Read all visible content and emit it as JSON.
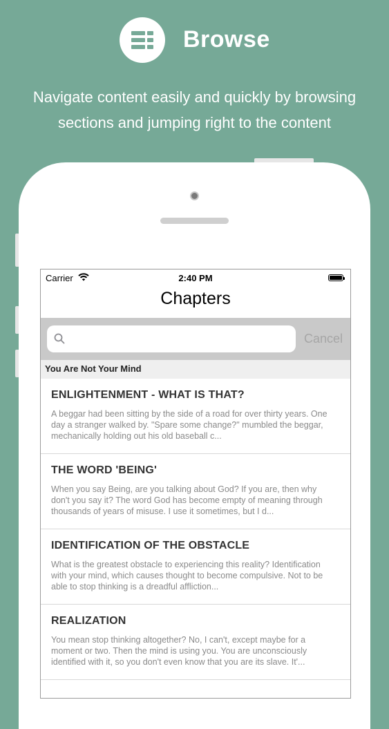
{
  "hero": {
    "title": "Browse",
    "subtitle_line1": "Navigate content easily and quickly by browsing",
    "subtitle_line2": "sections and jumping right to the content",
    "icon": "list-icon"
  },
  "status_bar": {
    "carrier": "Carrier",
    "time": "2:40 PM"
  },
  "nav": {
    "title": "Chapters"
  },
  "search": {
    "placeholder": "",
    "cancel_label": "Cancel"
  },
  "section": {
    "header": "You Are Not Your Mind"
  },
  "chapters": [
    {
      "title": "ENLIGHTENMENT - WHAT IS THAT?",
      "excerpt": "A beggar had been sitting by the side of a road for over thirty years. One day a stranger walked by. \"Spare some change?\" mumbled the beggar, mechanically holding out his old baseball c..."
    },
    {
      "title": "THE WORD 'BEING'",
      "excerpt": "When you say Being, are you talking about God? If you are, then why don't you say it? The word God has become empty of meaning through thousands of years of misuse. I use it sometimes, but I d..."
    },
    {
      "title": "IDENTIFICATION OF THE OBSTACLE",
      "excerpt": "What is the greatest obstacle to experiencing this reality? Identification with your mind, which causes thought to become compulsive. Not to be able to stop thinking is a dreadful affliction..."
    },
    {
      "title": "REALIZATION",
      "excerpt": "You mean stop thinking altogether? No, I can't, except maybe for a moment or two. Then the mind is using you. You are unconsciously identified with it, so you don't even know that you are its slave. It'..."
    }
  ],
  "colors": {
    "background": "#76a997",
    "search_bar": "#c9c9c9",
    "cancel": "#a6a6a6"
  }
}
